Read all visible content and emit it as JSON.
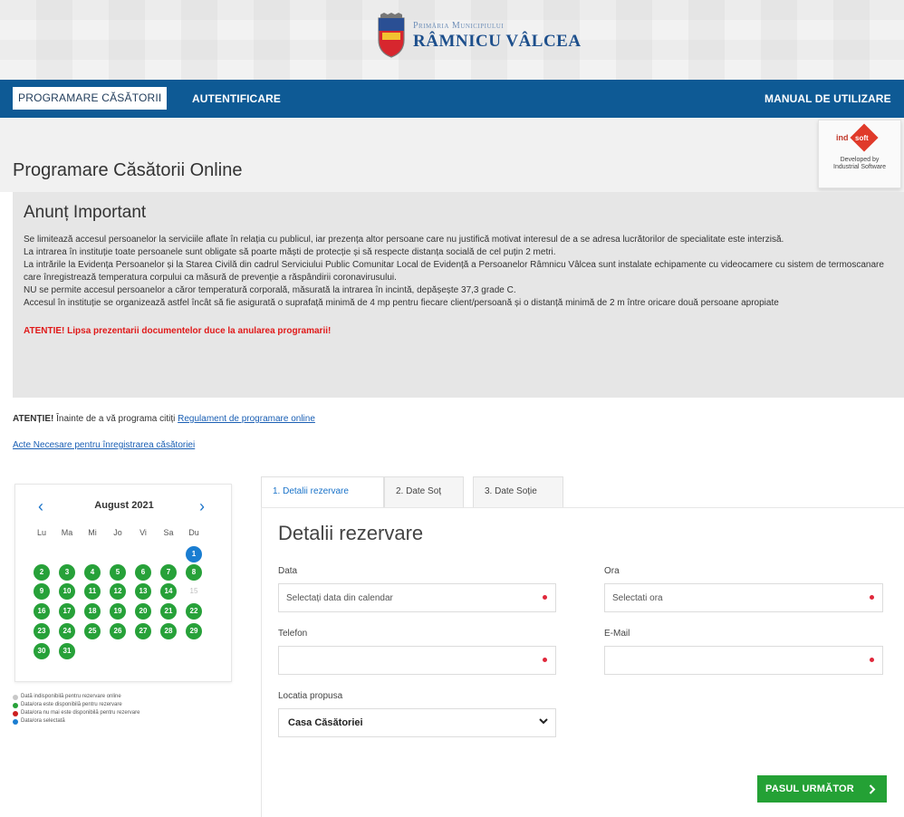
{
  "header": {
    "org_top": "Primăria Municipiului",
    "org_main": "RÂMNICU VÂLCEA"
  },
  "nav": {
    "active_label": "PROGRAMARE CĂSĂTORII",
    "auth_label": "AUTENTIFICARE",
    "manual_label": "MANUAL DE UTILIZARE"
  },
  "page_title": "Programare Căsătorii Online",
  "badge": {
    "brand_ind": "ind",
    "brand_soft": "soft",
    "dev_line1": "Developed by",
    "dev_line2": "Industrial Software"
  },
  "announcement": {
    "heading": "Anunț Important",
    "lines": [
      "Se limitează accesul persoanelor la serviciile aflate în relația cu publicul, iar prezența altor persoane care nu justifică motivat interesul de a se adresa lucrătorilor de specialitate este interzisă.",
      "La intrarea în instituție toate persoanele sunt obligate să poarte măști de protecție și să respecte distanța socială de cel puțin 2 metri.",
      "La intrările la Evidența Persoanelor și la Starea Civilă din cadrul Serviciului Public Comunitar Local de Evidență a Persoanelor Râmnicu Vâlcea sunt instalate echipamente cu videocamere cu sistem de termoscanare care înregistrează temperatura corpului ca măsură de prevenție a răspândirii coronavirusului.",
      "NU se permite accesul persoanelor a căror temperatură corporală, măsurată la intrarea în incintă, depășește 37,3 grade C.",
      "Accesul în instituție se organizează astfel încât să fie asigurată o suprafață minimă de 4 mp pentru fiecare client/persoană și o distanță minimă de 2 m între oricare două persoane apropiate"
    ],
    "warning": "ATENTIE! Lipsa prezentarii documentelor duce la anularea programarii!"
  },
  "attention": {
    "prefix_bold": "ATENȚIE!",
    "text": " Înainte de a vă programa citiți ",
    "link": "Regulament de programare online"
  },
  "acte_link": "Acte Necesare pentru înregistrarea căsătoriei",
  "calendar": {
    "month": "August 2021",
    "prev": "‹",
    "next": "›",
    "dow": [
      "Lu",
      "Ma",
      "Mi",
      "Jo",
      "Vi",
      "Sa",
      "Du"
    ],
    "days": [
      {
        "n": "1",
        "s": "sel"
      },
      {
        "n": "2",
        "s": "av"
      },
      {
        "n": "3",
        "s": "av"
      },
      {
        "n": "4",
        "s": "av"
      },
      {
        "n": "5",
        "s": "av"
      },
      {
        "n": "6",
        "s": "av"
      },
      {
        "n": "7",
        "s": "av"
      },
      {
        "n": "8",
        "s": "av"
      },
      {
        "n": "9",
        "s": "av"
      },
      {
        "n": "10",
        "s": "av"
      },
      {
        "n": "11",
        "s": "av"
      },
      {
        "n": "12",
        "s": "av"
      },
      {
        "n": "13",
        "s": "av"
      },
      {
        "n": "14",
        "s": "av"
      },
      {
        "n": "15",
        "s": "un"
      },
      {
        "n": "16",
        "s": "av"
      },
      {
        "n": "17",
        "s": "av"
      },
      {
        "n": "18",
        "s": "av"
      },
      {
        "n": "19",
        "s": "av"
      },
      {
        "n": "20",
        "s": "av"
      },
      {
        "n": "21",
        "s": "av"
      },
      {
        "n": "22",
        "s": "av"
      },
      {
        "n": "23",
        "s": "av"
      },
      {
        "n": "24",
        "s": "av"
      },
      {
        "n": "25",
        "s": "av"
      },
      {
        "n": "26",
        "s": "av"
      },
      {
        "n": "27",
        "s": "av"
      },
      {
        "n": "28",
        "s": "av"
      },
      {
        "n": "29",
        "s": "av"
      },
      {
        "n": "30",
        "s": "av"
      },
      {
        "n": "31",
        "s": "av"
      }
    ]
  },
  "legend": [
    {
      "color": "#c8c8c8",
      "text": "Dată indisponibilă pentru rezervare online"
    },
    {
      "color": "#27a139",
      "text": "Data/ora este disponibilă pentru rezervare"
    },
    {
      "color": "#cc1f1f",
      "text": "Data/ora nu mai este disponibilă pentru rezervare"
    },
    {
      "color": "#1a7dd1",
      "text": "Data/ora selectată"
    }
  ],
  "tabs": [
    "1. Detalii rezervare",
    "2. Date Soț",
    "3. Date Soție"
  ],
  "form": {
    "title": "Detalii rezervare",
    "data_label": "Data",
    "data_placeholder": "Selectați data din calendar",
    "ora_label": "Ora",
    "ora_placeholder": "Selectati ora",
    "telefon_label": "Telefon",
    "telefon_value": "",
    "email_label": "E-Mail",
    "email_value": "",
    "locatia_label": "Locatia propusa",
    "locatia_value": "Casa Căsătoriei",
    "next_button": "PASUL URMĂTOR"
  },
  "colors": {
    "nav_bg": "#0e5a95",
    "accent_green": "#27a139",
    "selected_blue": "#1a7dd1",
    "required_red": "#e0283b",
    "warning_red": "#e01919"
  }
}
